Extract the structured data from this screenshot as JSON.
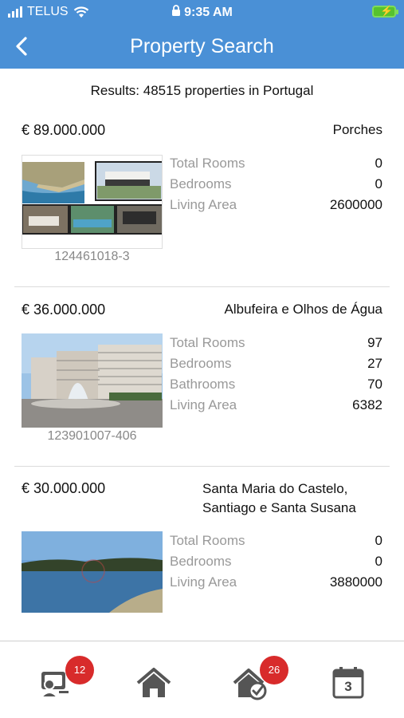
{
  "status_bar": {
    "carrier": "TELUS",
    "time": "9:35 AM",
    "icons": [
      "signal-icon",
      "wifi-icon",
      "lock-icon",
      "battery-charging-icon"
    ]
  },
  "header": {
    "title": "Property Search",
    "back_icon": "chevron-left-icon"
  },
  "results": {
    "text": "Results: 48515 properties in Portugal"
  },
  "listings": [
    {
      "price": "€ 89.000.000",
      "location": "Porches",
      "ref": "124461018-3",
      "specs": [
        {
          "label": "Total Rooms",
          "value": "0"
        },
        {
          "label": "Bedrooms",
          "value": "0"
        },
        {
          "label": "Living Area",
          "value": "2600000"
        }
      ]
    },
    {
      "price": "€ 36.000.000",
      "location": "Albufeira e Olhos de Água",
      "ref": "123901007-406",
      "specs": [
        {
          "label": "Total Rooms",
          "value": "97"
        },
        {
          "label": "Bedrooms",
          "value": "27"
        },
        {
          "label": "Bathrooms",
          "value": "70"
        },
        {
          "label": "Living Area",
          "value": "6382"
        }
      ]
    },
    {
      "price": "€ 30.000.000",
      "location_line1": "Santa Maria do Castelo,",
      "location_line2": "Santiago e Santa Susana",
      "specs": [
        {
          "label": "Total Rooms",
          "value": "0"
        },
        {
          "label": "Bedrooms",
          "value": "0"
        },
        {
          "label": "Living Area",
          "value": "3880000"
        }
      ]
    }
  ],
  "tab_bar": {
    "tabs": [
      {
        "icon": "contacts-icon",
        "badge": "12"
      },
      {
        "icon": "home-icon"
      },
      {
        "icon": "home-check-icon",
        "badge": "26"
      },
      {
        "icon": "calendar-icon",
        "day": "3"
      }
    ]
  },
  "colors": {
    "header": "#4a90d6",
    "badge": "#d82b2b",
    "muted_text": "#999999"
  }
}
